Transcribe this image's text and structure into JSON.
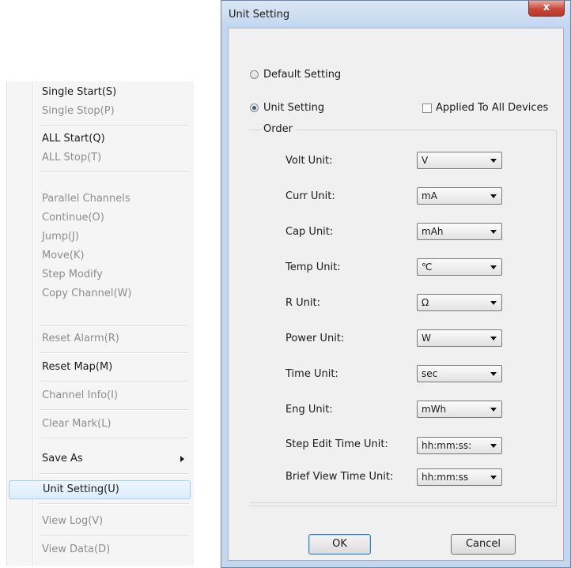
{
  "context_menu": {
    "items": [
      {
        "label": "Single Start(S)",
        "enabled": true
      },
      {
        "label": "Single Stop(P)",
        "enabled": false
      },
      {
        "label": "ALL Start(Q)",
        "enabled": true
      },
      {
        "label": "ALL Stop(T)",
        "enabled": false
      },
      {
        "label": "Parallel Channels",
        "enabled": false
      },
      {
        "label": "Continue(O)",
        "enabled": false
      },
      {
        "label": "Jump(J)",
        "enabled": false
      },
      {
        "label": "Move(K)",
        "enabled": false
      },
      {
        "label": "Step Modify",
        "enabled": false
      },
      {
        "label": "Copy Channel(W)",
        "enabled": false
      },
      {
        "label": "Reset Alarm(R)",
        "enabled": false
      },
      {
        "label": "Reset Map(M)",
        "enabled": true
      },
      {
        "label": "Channel Info(I)",
        "enabled": false
      },
      {
        "label": "Clear Mark(L)",
        "enabled": false
      },
      {
        "label": "Save As",
        "enabled": true,
        "submenu": true
      },
      {
        "label": "Unit Setting(U)",
        "enabled": true,
        "selected": true
      },
      {
        "label": "View Log(V)",
        "enabled": false
      },
      {
        "label": "View Data(D)",
        "enabled": false
      }
    ]
  },
  "dialog": {
    "title": "Unit Setting",
    "close_glyph": "x",
    "default_setting_label": "Default Setting",
    "unit_setting_label": "Unit Setting",
    "selected_mode": "Unit Setting",
    "applied_all_label": "Applied To All Devices",
    "applied_all_checked": false,
    "order_label": "Order",
    "fields": [
      {
        "label": "Volt Unit:",
        "value": "V"
      },
      {
        "label": "Curr Unit:",
        "value": "mA"
      },
      {
        "label": "Cap Unit:",
        "value": "mAh"
      },
      {
        "label": "Temp Unit:",
        "value": "℃"
      },
      {
        "label": "R Unit:",
        "value": "Ω"
      },
      {
        "label": "Power Unit:",
        "value": "W"
      },
      {
        "label": "Time Unit:",
        "value": "sec"
      },
      {
        "label": "Eng Unit:",
        "value": "mWh"
      },
      {
        "label": "Step Edit Time Unit:",
        "value": "hh:mm:ss:"
      },
      {
        "label": "Brief View Time Unit:",
        "value": "hh:mm:ss"
      }
    ],
    "ok_label": "OK",
    "cancel_label": "Cancel"
  }
}
